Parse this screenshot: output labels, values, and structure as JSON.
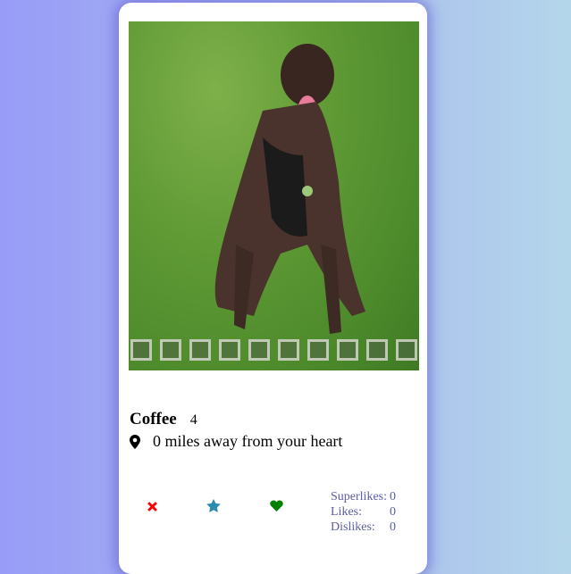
{
  "profile": {
    "name": "Coffee",
    "age": "4",
    "distance": "0 miles away from your heart",
    "photo_count": 10
  },
  "actions": {
    "dislike_icon": "x-icon",
    "superlike_icon": "star-icon",
    "like_icon": "heart-icon",
    "colors": {
      "dislike": "#ff0000",
      "superlike": "#2e8bb0",
      "like": "#008000"
    }
  },
  "stats": [
    {
      "label": "Superlikes:",
      "value": "0"
    },
    {
      "label": "Likes:",
      "value": "0"
    },
    {
      "label": "Dislikes:",
      "value": "0"
    }
  ]
}
